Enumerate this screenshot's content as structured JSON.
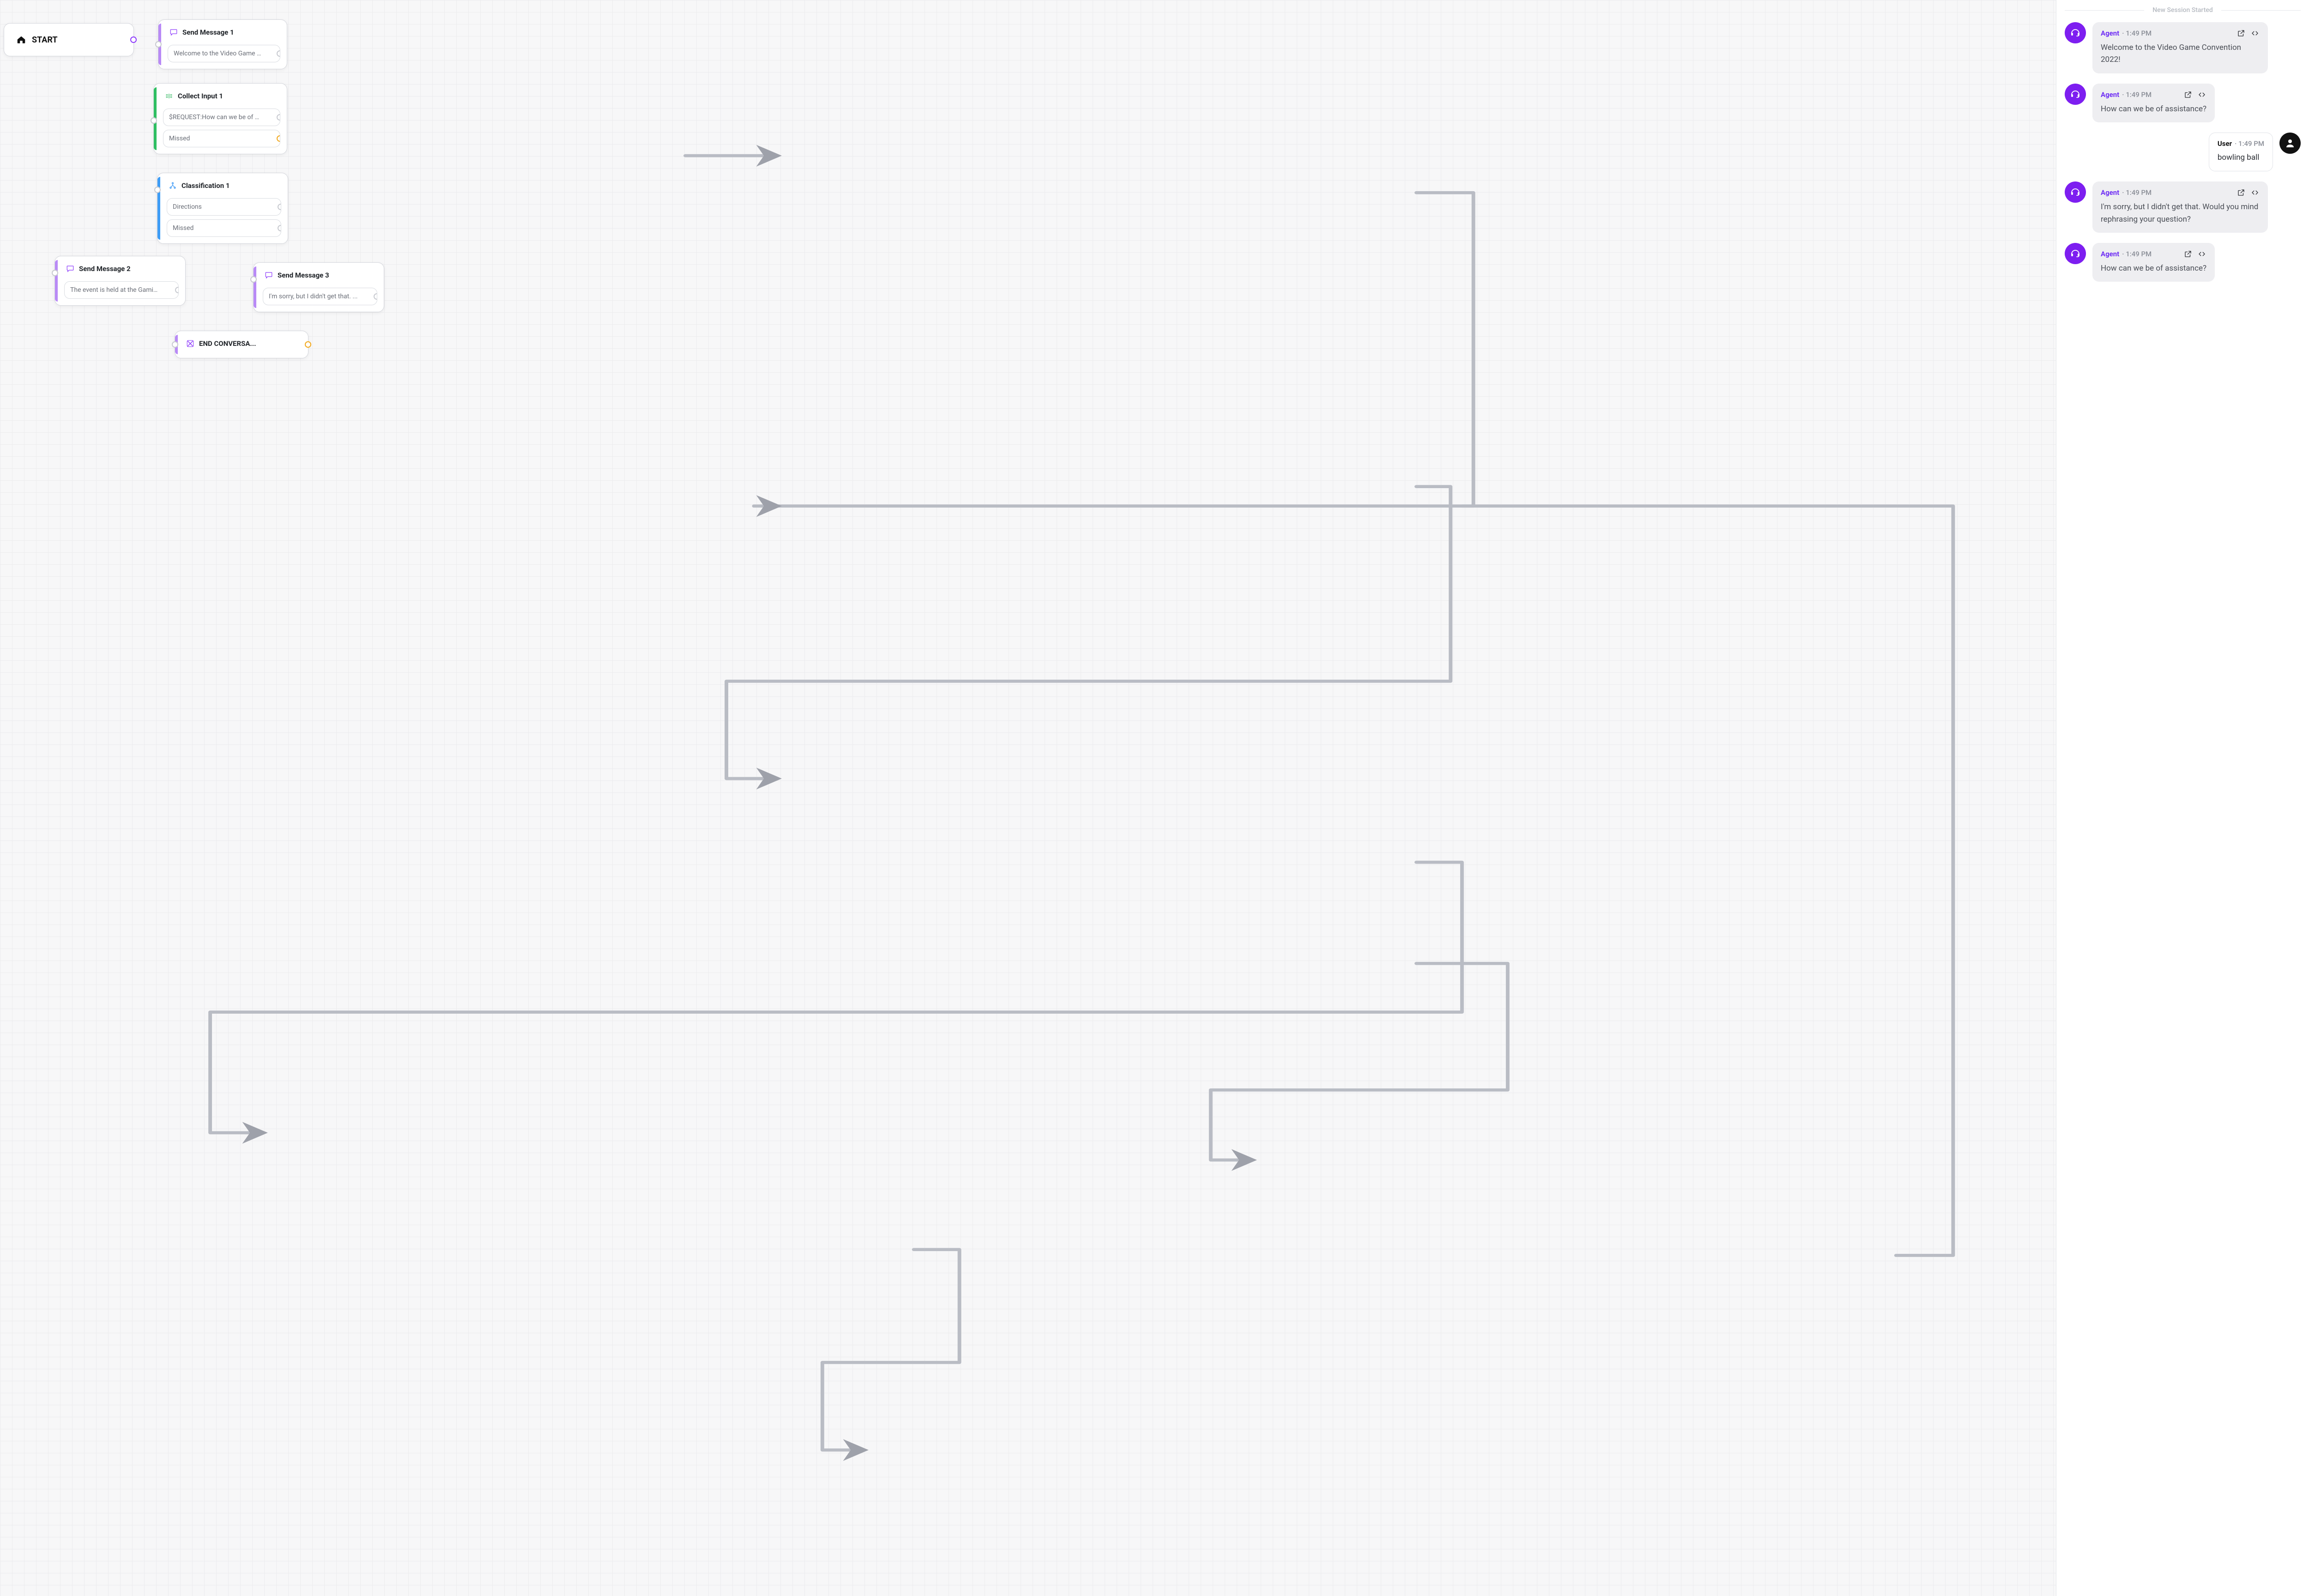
{
  "colors": {
    "accent_purple": "#8d3afc",
    "accent_green": "#22b253",
    "accent_blue": "#2a8ff5",
    "accent_orange": "#f2a91e",
    "agent_avatar": "#7d1ef0"
  },
  "canvas": {
    "start": {
      "label": "START"
    },
    "nodes": {
      "send1": {
        "title": "Send Message 1",
        "icon": "chat-icon",
        "accent": "purple",
        "slots": [
          {
            "text": "Welcome to the Video Game Co...",
            "port": "plain"
          }
        ]
      },
      "collect1": {
        "title": "Collect Input 1",
        "icon": "input-icon",
        "accent": "green",
        "slots": [
          {
            "text": "$REQUEST:How can we be of assis",
            "port": "plain"
          },
          {
            "text": "Missed",
            "port": "orange"
          }
        ]
      },
      "class1": {
        "title": "Classification 1",
        "icon": "branch-icon",
        "accent": "blue",
        "slots": [
          {
            "text": "Directions",
            "port": "plain"
          },
          {
            "text": "Missed",
            "port": "plain"
          }
        ]
      },
      "send2": {
        "title": "Send Message 2",
        "icon": "chat-icon",
        "accent": "purple",
        "slots": [
          {
            "text": "The event is held at the Gaming...",
            "port": "plain"
          }
        ]
      },
      "send3": {
        "title": "Send Message 3",
        "icon": "chat-icon",
        "accent": "purple",
        "slots": [
          {
            "text": "I'm sorry, but I didn't get that. ...",
            "port": "plain"
          }
        ]
      },
      "end": {
        "title": "END CONVERSA...",
        "icon": "end-icon",
        "accent": "purple",
        "port": "orange"
      }
    }
  },
  "chat": {
    "session_label": "New Session Started",
    "entries": [
      {
        "role": "agent",
        "sender": "Agent",
        "time": "1:49 PM",
        "body": "Welcome to the Video Game Convention 2022!",
        "actions": true
      },
      {
        "role": "agent",
        "sender": "Agent",
        "time": "1:49 PM",
        "body": "How can we be of assistance?",
        "actions": true
      },
      {
        "role": "user",
        "sender": "User",
        "time": "1:49 PM",
        "body": "bowling ball",
        "actions": false
      },
      {
        "role": "agent",
        "sender": "Agent",
        "time": "1:49 PM",
        "body": "I'm sorry, but I didn't get that. Would you mind rephrasing your question?",
        "actions": true
      },
      {
        "role": "agent",
        "sender": "Agent",
        "time": "1:49 PM",
        "body": "How can we be of assistance?",
        "actions": true
      }
    ]
  }
}
